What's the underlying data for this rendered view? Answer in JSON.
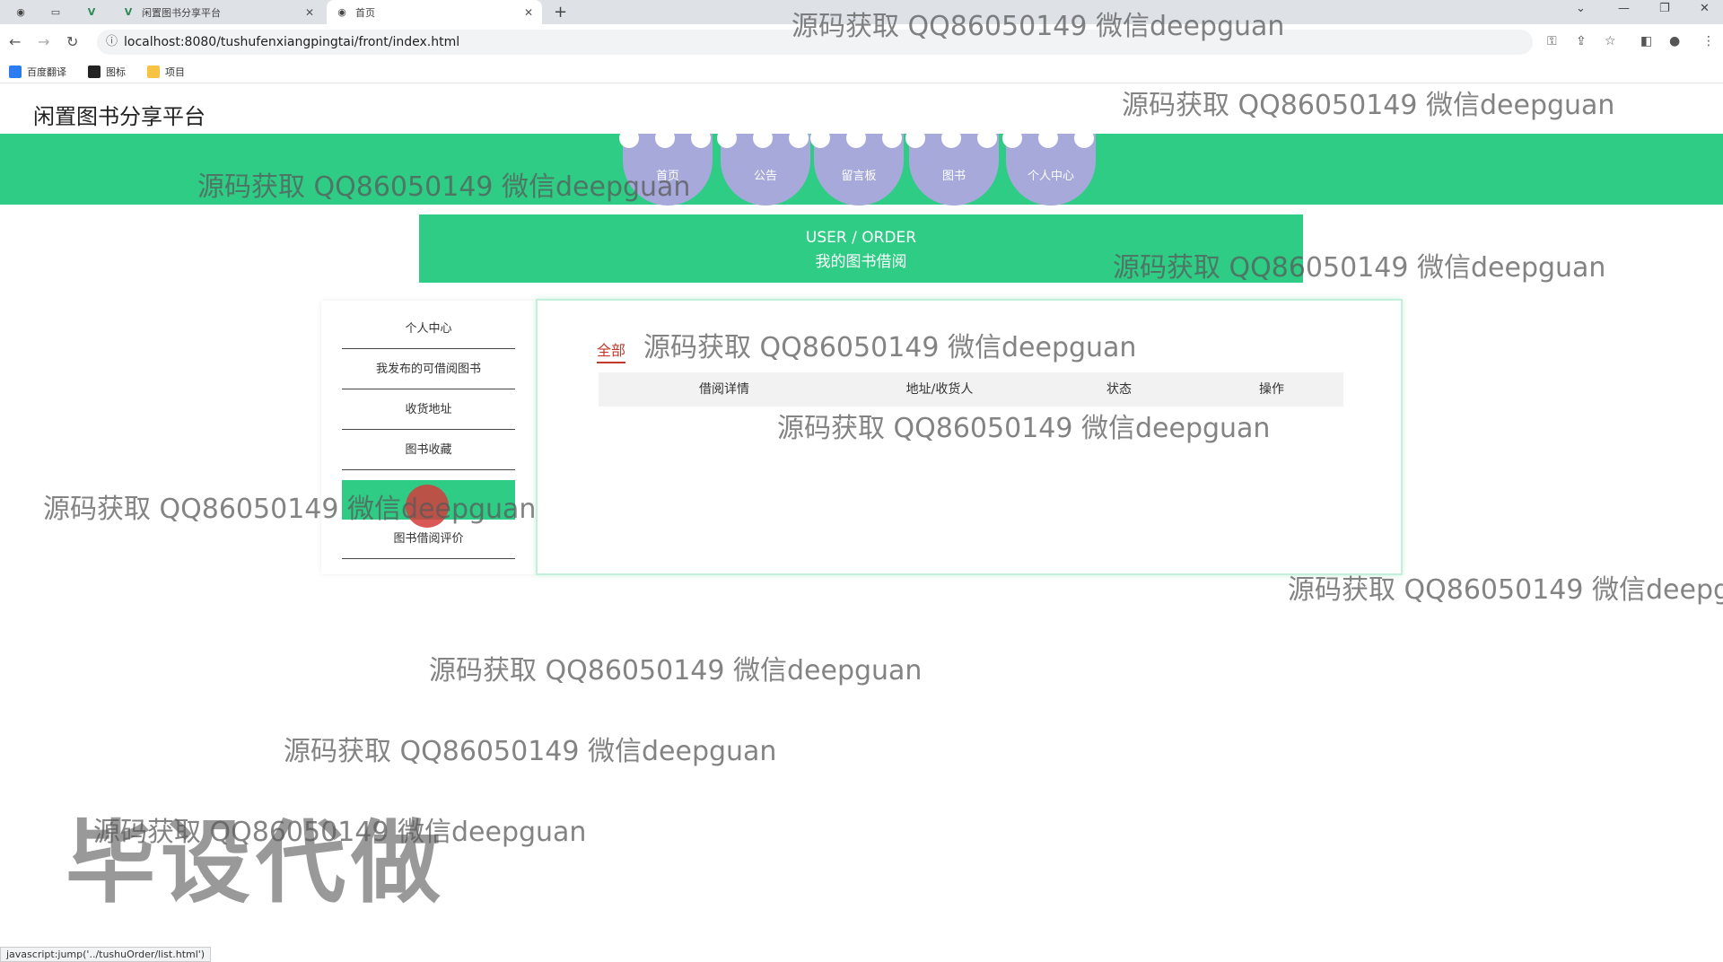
{
  "browser": {
    "tabs": [
      {
        "label": ""
      },
      {
        "label": ""
      },
      {
        "label": ""
      },
      {
        "label": "闲置图书分享平台"
      },
      {
        "label": "首页"
      }
    ],
    "new_tab": "+",
    "url": "localhost:8080/tushufenxiangpingtai/front/index.html",
    "bookmarks": [
      {
        "label": "百度翻译",
        "color": "#2d7cf0"
      },
      {
        "label": "图标",
        "color": "#222222"
      },
      {
        "label": "项目",
        "color": "#f6c343"
      }
    ]
  },
  "site": {
    "title": "闲置图书分享平台",
    "nav": [
      {
        "label": "首页"
      },
      {
        "label": "公告"
      },
      {
        "label": "留言板"
      },
      {
        "label": "图书"
      },
      {
        "label": "个人中心"
      }
    ]
  },
  "banner": {
    "en": "USER / ORDER",
    "cn": "我的图书借阅"
  },
  "sidebar": {
    "items": [
      {
        "label": "个人中心"
      },
      {
        "label": "我发布的可借阅图书"
      },
      {
        "label": "收货地址"
      },
      {
        "label": "图书收藏"
      },
      {
        "label": ""
      },
      {
        "label": "图书借阅评价"
      }
    ]
  },
  "orders": {
    "filter": "全部",
    "columns": [
      "借阅详情",
      "地址/收货人",
      "状态",
      "操作"
    ]
  },
  "watermark": {
    "text": "源码获取 QQ86050149 微信deepguan",
    "big": "毕设代做"
  },
  "statusbar": "javascript:jump('../tushuOrder/list.html')",
  "colors": {
    "brand_green": "#2ecc85",
    "nav_bubble": "#a6a9d9",
    "filter_red": "#c0392b"
  }
}
